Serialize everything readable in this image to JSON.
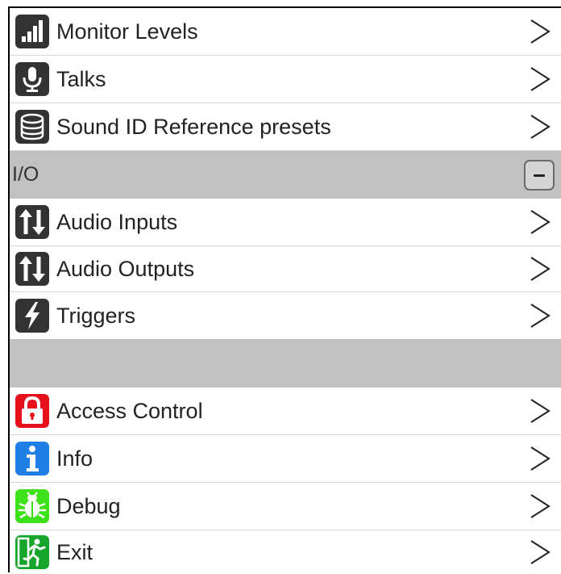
{
  "menu": {
    "items_top": [
      {
        "label": "Monitor Levels",
        "icon": "signal-bars-icon",
        "icon_color": "#333333"
      },
      {
        "label": "Talks",
        "icon": "microphone-icon",
        "icon_color": "#333333"
      },
      {
        "label": "Sound ID Reference presets",
        "icon": "database-icon",
        "icon_color": "#333333"
      }
    ],
    "io_section": {
      "label": "I/O",
      "collapse_symbol": "−"
    },
    "items_io": [
      {
        "label": "Audio Inputs",
        "icon": "up-down-arrows-icon",
        "icon_color": "#333333"
      },
      {
        "label": "Audio Outputs",
        "icon": "up-down-arrows-icon",
        "icon_color": "#333333"
      },
      {
        "label": "Triggers",
        "icon": "lightning-icon",
        "icon_color": "#333333"
      }
    ],
    "items_bottom": [
      {
        "label": "Access Control",
        "icon": "lock-icon",
        "icon_color": "#e8101a"
      },
      {
        "label": "Info",
        "icon": "info-icon",
        "icon_color": "#1f7fe6"
      },
      {
        "label": "Debug",
        "icon": "bug-icon",
        "icon_color": "#3ee21a"
      },
      {
        "label": "Exit",
        "icon": "exit-running-man-icon",
        "icon_color": "#17a52c"
      }
    ]
  },
  "colors": {
    "section_bg": "#c1c1c1",
    "divider": "#d6d6d6"
  }
}
